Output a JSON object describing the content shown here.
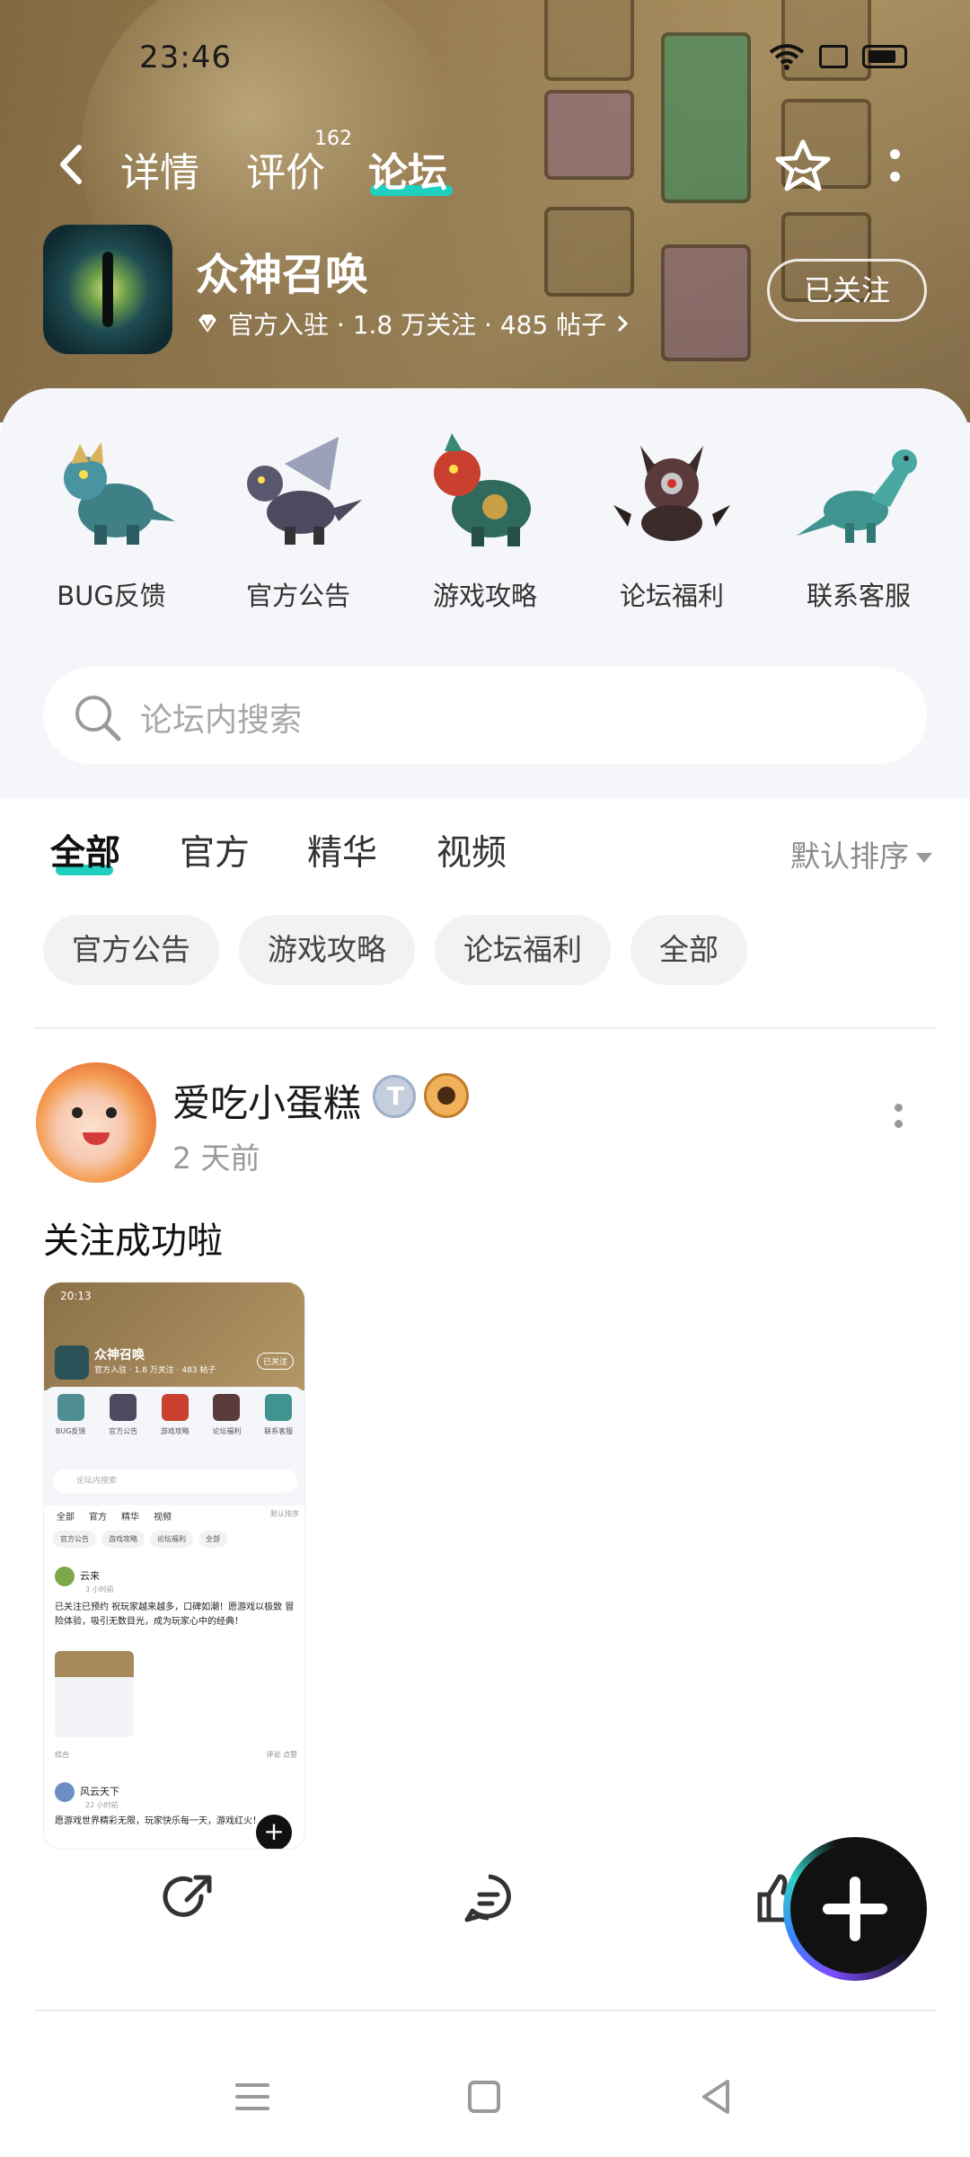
{
  "status": {
    "time": "23:46"
  },
  "nav": {
    "tabs": [
      {
        "label": "详情"
      },
      {
        "label": "评价",
        "badge": "162"
      },
      {
        "label": "论坛"
      }
    ]
  },
  "game": {
    "name": "众神召唤",
    "meta": "官方入驻 · 1.8 万关注 · 485 帖子",
    "follow_label": "已关注"
  },
  "categories": [
    {
      "label": "BUG反馈",
      "color": "#3f7f86"
    },
    {
      "label": "官方公告",
      "color": "#4c4a5e"
    },
    {
      "label": "游戏攻略",
      "color": "#2f6a5c"
    },
    {
      "label": "论坛福利",
      "color": "#5a3a3a"
    },
    {
      "label": "联系客服",
      "color": "#3f9490"
    }
  ],
  "search": {
    "placeholder": "论坛内搜索"
  },
  "tabs": {
    "items": [
      "全部",
      "官方",
      "精华",
      "视频"
    ],
    "sort_label": "默认排序"
  },
  "chips": [
    "官方公告",
    "游戏攻略",
    "论坛福利",
    "全部"
  ],
  "post": {
    "username": "爱吃小蛋糕",
    "time": "2 天前",
    "text": "关注成功啦",
    "screenshot": {
      "time": "20:13",
      "title": "众神召唤",
      "sub": "官方入驻 · 1.8 万关注 · 483 帖子",
      "follow": "已关注",
      "cats": [
        "BUG反馈",
        "官方公告",
        "游戏攻略",
        "论坛福利",
        "联系客服"
      ],
      "search": "论坛内搜索",
      "tabs": [
        "全部",
        "官方",
        "精华",
        "视频"
      ],
      "sort": "默认排序",
      "chips": [
        "官方公告",
        "游戏攻略",
        "论坛福利",
        "全部"
      ],
      "user1": "云来",
      "time1": "3 小时前",
      "post1": "已关注已预约 祝玩家越来越多，口碑如潮！愿游戏以极致 冒险体验，吸引无数目光，成为玩家心中的经典！",
      "foot_left": "综合",
      "foot_right": "评论   点赞",
      "user2": "风云天下",
      "time2": "22 小时前",
      "post2": "愿游戏世界精彩无限，玩家快乐每一天，游戏红火！"
    }
  }
}
